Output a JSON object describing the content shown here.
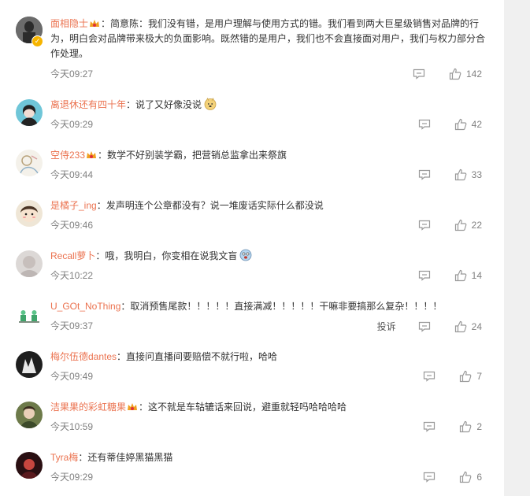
{
  "comments": [
    {
      "user": "面相隐士",
      "text": "：简意陈：我们没有错，是用户理解与使用方式的错。我们看到两大巨星级销售对品牌的行为，明白会对品牌带来极大的负面影响。既然错的是用户，我们也不会直接面对用户，我们与权力部分合作处理。",
      "time": "今天09:27",
      "likes": "142",
      "avatar": "avatar-statue",
      "verified": true,
      "crown": true
    },
    {
      "user": "离退休还有四十年",
      "text": "：说了又好像没说",
      "time": "今天09:29",
      "likes": "42",
      "avatar": "avatar-girl-blue",
      "emoji": "doge-emoji"
    },
    {
      "user": "空侍233",
      "text": "：数学不好别装学霸，把营销总监拿出来祭旗",
      "time": "今天09:44",
      "likes": "33",
      "avatar": "avatar-sketch",
      "crown": true
    },
    {
      "user": "是橘子_ing",
      "text": "：发声明连个公章都没有？说一堆废话实际什么都没说",
      "time": "今天09:46",
      "likes": "22",
      "avatar": "avatar-cartoon-girl"
    },
    {
      "user": "Recall萝卜",
      "text": "：哦，我明白，你变相在说我文盲",
      "time": "今天10:22",
      "likes": "14",
      "avatar": "avatar-blurry",
      "emoji": "scared-emoji"
    },
    {
      "user": "U_GOt_NoThing",
      "text": "：取消预售尾款！！！！！直接满减！！！！！干嘛非要搞那么复杂！！！！",
      "time": "今天09:37",
      "likes": "24",
      "avatar": "avatar-plants",
      "report": "投诉"
    },
    {
      "user": "梅尔伍德dantes",
      "text": "：直接问直播间要赔偿不就行啦，哈哈",
      "time": "今天09:49",
      "likes": "7",
      "avatar": "avatar-dark"
    },
    {
      "user": "洁果果的彩虹糖果",
      "text": "：这不就是车轱辘话来回说，避重就轻吗哈哈哈哈",
      "time": "今天10:59",
      "likes": "2",
      "avatar": "avatar-green",
      "crown": true
    },
    {
      "user": "Tyra梅",
      "text": "：还有蒂佳婷黑猫黑猫",
      "time": "今天09:29",
      "likes": "6",
      "avatar": "avatar-red"
    }
  ],
  "colors": {
    "username": "#eb7350",
    "meta": "#808080",
    "scrollbar": "#f0f0f0"
  }
}
